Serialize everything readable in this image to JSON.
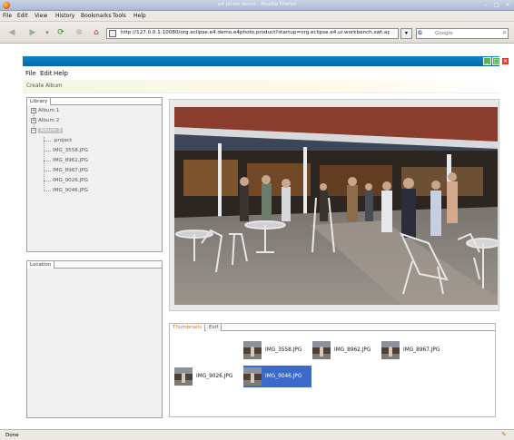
{
  "browser": {
    "title": "e4 photo demo - Mozilla Firefox",
    "menu": [
      "File",
      "Edit",
      "View",
      "History",
      "Bookmarks",
      "Tools",
      "Help"
    ],
    "url": "http://127.0.0.1:10080/org.eclipse.e4.demo.e4photo.product?startup=org.eclipse.e4.ui.workbench.swt.applicatio",
    "search_placeholder": "Google",
    "search_engine": "G",
    "status": "Done"
  },
  "app": {
    "menu": [
      "File",
      "Edit",
      "Help"
    ],
    "toolbar_label": "Create Album",
    "library": {
      "tab": "Library",
      "albums": [
        "Album 1",
        "Album 2",
        "Album 3"
      ],
      "selected_album": "Album 3",
      "files": [
        ".project",
        "IMG_3558.JPG",
        "IMG_8962.JPG",
        "IMG_8967.JPG",
        "IMG_9026.JPG",
        "IMG_9046.JPG"
      ]
    },
    "location": {
      "tab": "Location"
    },
    "viewer_tabs": [
      {
        "label": "Thumbnails",
        "active": true
      },
      {
        "label": "Exif",
        "active": false
      }
    ],
    "thumbnails": [
      {
        "label": "IMG_3558.JPG",
        "selected": false
      },
      {
        "label": "IMG_8962.JPG",
        "selected": false
      },
      {
        "label": "IMG_8967.JPG",
        "selected": false
      },
      {
        "label": "IMG_9026.JPG",
        "selected": false
      },
      {
        "label": "IMG_9046.JPG",
        "selected": true
      }
    ]
  },
  "colors": {
    "app_titlebar": "#0a72b9",
    "selection": "#3c6ac8",
    "active_tab_text": "#e56a00"
  }
}
